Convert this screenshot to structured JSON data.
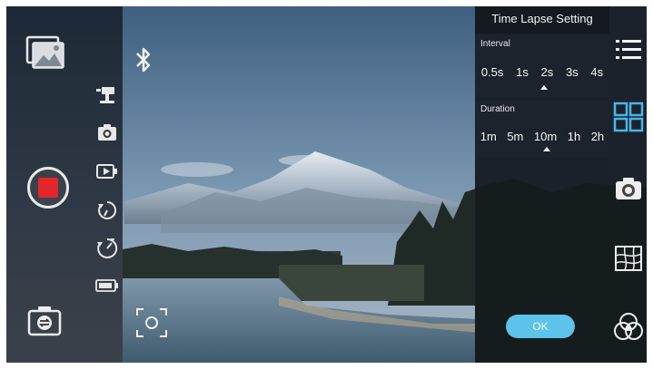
{
  "colors": {
    "record_red": "#e2262a",
    "ok_blue": "#5ec3ea",
    "accent_blue": "#48b6e8"
  },
  "left_panel": {
    "icons": [
      "gallery-icon",
      "record-button",
      "switch-camera-icon"
    ],
    "mode_icons": [
      "gimbal-mode-icon",
      "photo-mode-icon",
      "video-mode-icon",
      "timelapse-mode-icon",
      "hyperlapse-mode-icon",
      "battery-icon"
    ]
  },
  "viewfinder": {
    "icons": [
      "bluetooth-icon",
      "focus-icon"
    ]
  },
  "timelapse": {
    "title": "Time Lapse Setting",
    "interval": {
      "label": "Interval",
      "options": [
        "0.5s",
        "1s",
        "2s",
        "3s",
        "4s"
      ],
      "selected": "2s"
    },
    "duration": {
      "label": "Duration",
      "options": [
        "1m",
        "5m",
        "10m",
        "1h",
        "2h"
      ],
      "selected": "10m"
    },
    "ok_label": "OK"
  },
  "right_strip": {
    "icons": [
      "menu-icon",
      "grid-icon",
      "camera-settings-icon",
      "map-icon",
      "filter-icon"
    ]
  }
}
